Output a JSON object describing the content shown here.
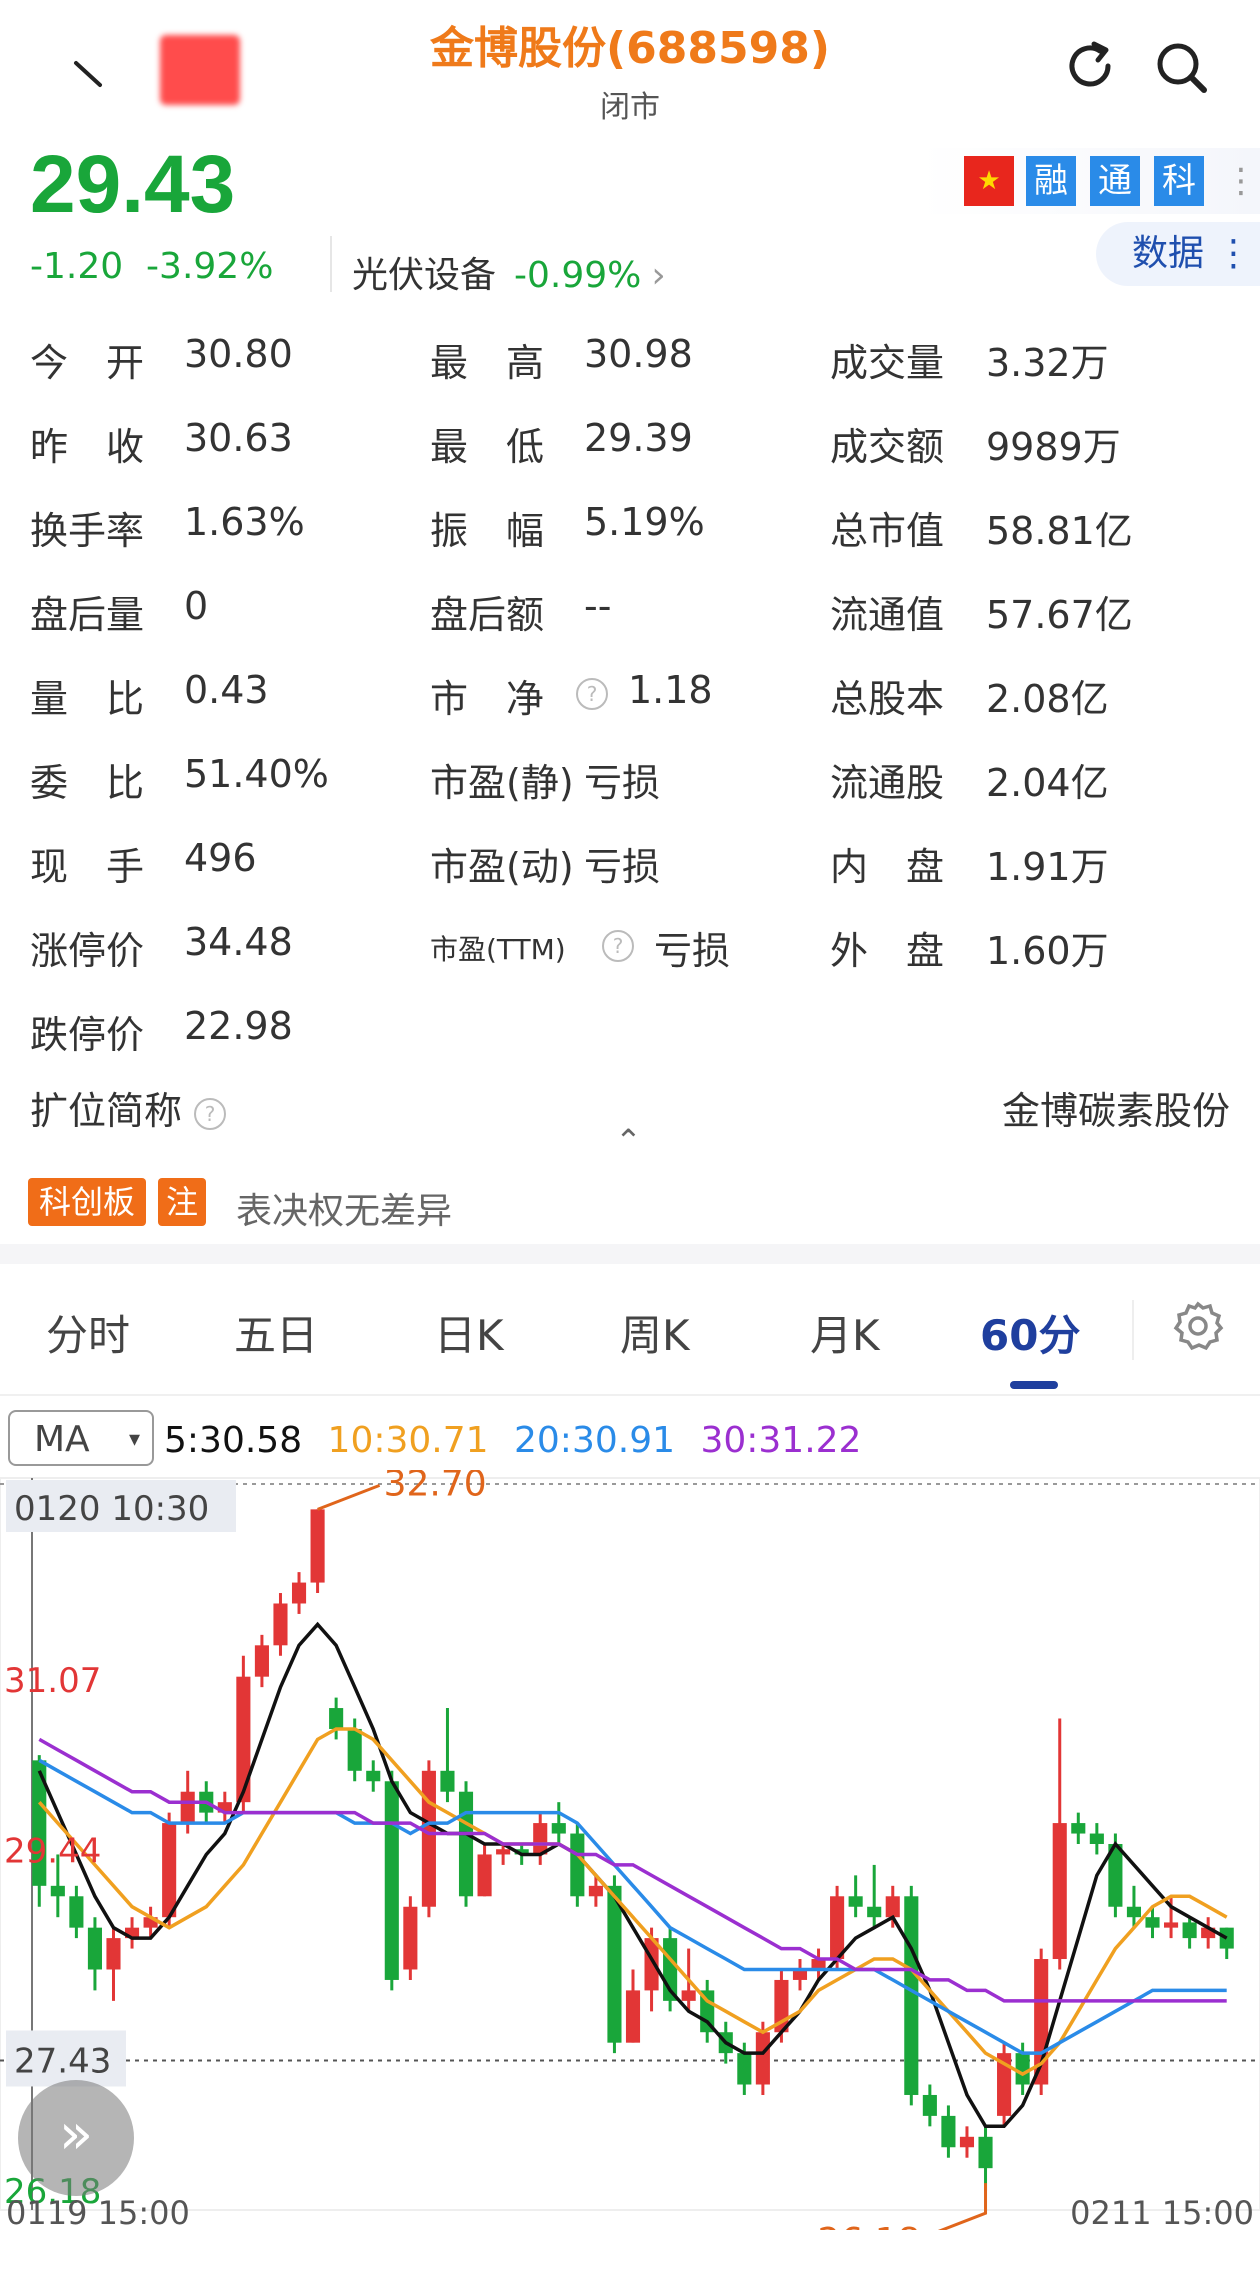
{
  "header": {
    "title": "金博股份(688598)",
    "status": "闭市",
    "back_icon": "back-arrow-icon",
    "refresh_icon": "refresh-icon",
    "search_icon": "search-icon"
  },
  "quote": {
    "price": "29.43",
    "change": "-1.20",
    "change_pct": "-3.92%",
    "sector": "光伏设备",
    "sector_pct": "-0.99%",
    "sector_arrow": "›",
    "color_down": "#19a63a",
    "color_up": "#e23636"
  },
  "badges": {
    "flag": "★",
    "b1": "融",
    "b2": "通",
    "b3": "科",
    "more": "⋮",
    "data_button": "数据 ⋮"
  },
  "stats": {
    "col1": [
      {
        "label": "今　开",
        "value": "30.80"
      },
      {
        "label": "昨　收",
        "value": "30.63"
      },
      {
        "label": "换手率",
        "value": "1.63%"
      },
      {
        "label": "盘后量",
        "value": "0"
      },
      {
        "label": "量　比",
        "value": "0.43"
      },
      {
        "label": "委　比",
        "value": "51.40%"
      },
      {
        "label": "现　手",
        "value": "496"
      },
      {
        "label": "涨停价",
        "value": "34.48"
      },
      {
        "label": "跌停价",
        "value": "22.98"
      }
    ],
    "col2": [
      {
        "label": "最　高",
        "value": "30.98"
      },
      {
        "label": "最　低",
        "value": "29.39"
      },
      {
        "label": "振　幅",
        "value": "5.19%"
      },
      {
        "label": "盘后额",
        "value": "--"
      },
      {
        "label": "市　净",
        "value": "1.18"
      },
      {
        "label": "市盈(静)",
        "value": "亏损"
      },
      {
        "label": "市盈(动)",
        "value": "亏损"
      },
      {
        "label": "市盈(TTM)",
        "value": "亏损"
      }
    ],
    "col3": [
      {
        "label": "成交量",
        "value": "3.32万"
      },
      {
        "label": "成交额",
        "value": "9989万"
      },
      {
        "label": "总市值",
        "value": "58.81亿"
      },
      {
        "label": "流通值",
        "value": "57.67亿"
      },
      {
        "label": "总股本",
        "value": "2.08亿"
      },
      {
        "label": "流通股",
        "value": "2.04亿"
      },
      {
        "label": "内　盘",
        "value": "1.91万"
      },
      {
        "label": "外　盘",
        "value": "1.60万"
      }
    ],
    "expand_label": "扩位简称",
    "expand_value": "金博碳素股份",
    "collapse": "⌃",
    "help_mark": "?"
  },
  "tags": {
    "board": "科创板",
    "note": "注",
    "text": "表决权无差异"
  },
  "tabs": [
    "分时",
    "五日",
    "日K",
    "周K",
    "月K",
    "60分"
  ],
  "active_tab": "60分",
  "settings_icon": "gear-icon",
  "ma": {
    "selector": "MA",
    "selector_arrow": "▾",
    "ma5": "5:30.58",
    "ma10": "10:30.71",
    "ma20": "20:30.91",
    "ma30": "30:31.22",
    "colors": {
      "ma5": "#111111",
      "ma10": "#f0a020",
      "ma20": "#2a8be8",
      "ma30": "#9b2fd0"
    }
  },
  "chart_data": {
    "type": "candlestick",
    "interval": "60分",
    "y_labels": [
      "31.07",
      "29.44",
      "27.43",
      "26.18"
    ],
    "high_label": "32.70",
    "low_label": "26.18",
    "crosshair_label": "0120 10:30",
    "dashed_level": "27.43",
    "x_start": "0119 15:00",
    "x_end": "0211 15:00",
    "ylim": [
      26.0,
      33.0
    ],
    "candles": [
      [
        30.3,
        29.1,
        30.35,
        28.9
      ],
      [
        29.1,
        29.0,
        29.4,
        28.8
      ],
      [
        29.0,
        28.7,
        29.1,
        28.6
      ],
      [
        28.7,
        28.3,
        28.8,
        28.1
      ],
      [
        28.3,
        28.6,
        28.7,
        28.0
      ],
      [
        28.6,
        28.7,
        28.8,
        28.5
      ],
      [
        28.7,
        28.8,
        28.9,
        28.6
      ],
      [
        28.8,
        29.7,
        29.8,
        28.7
      ],
      [
        29.7,
        30.0,
        30.2,
        29.6
      ],
      [
        30.0,
        29.8,
        30.1,
        29.7
      ],
      [
        29.8,
        29.9,
        30.0,
        29.7
      ],
      [
        29.9,
        31.1,
        31.3,
        29.8
      ],
      [
        31.1,
        31.4,
        31.5,
        31.0
      ],
      [
        31.4,
        31.8,
        31.9,
        31.3
      ],
      [
        31.8,
        32.0,
        32.1,
        31.7
      ],
      [
        32.0,
        32.7,
        32.7,
        31.9
      ],
      [
        30.8,
        30.6,
        30.9,
        30.5
      ],
      [
        30.6,
        30.2,
        30.7,
        30.1
      ],
      [
        30.2,
        30.1,
        30.3,
        30.0
      ],
      [
        30.1,
        28.2,
        30.2,
        28.1
      ],
      [
        28.3,
        28.9,
        29.0,
        28.2
      ],
      [
        28.9,
        30.2,
        30.3,
        28.8
      ],
      [
        30.2,
        30.0,
        30.8,
        29.9
      ],
      [
        30.0,
        29.0,
        30.1,
        28.9
      ],
      [
        29.0,
        29.4,
        29.5,
        29.0
      ],
      [
        29.4,
        29.45,
        29.5,
        29.3
      ],
      [
        29.45,
        29.4,
        29.5,
        29.3
      ],
      [
        29.4,
        29.7,
        29.8,
        29.3
      ],
      [
        29.7,
        29.6,
        29.9,
        29.5
      ],
      [
        29.6,
        29.0,
        29.7,
        28.9
      ],
      [
        29.0,
        29.1,
        29.2,
        28.9
      ],
      [
        29.1,
        27.6,
        29.2,
        27.5
      ],
      [
        27.6,
        28.1,
        28.3,
        27.6
      ],
      [
        28.1,
        28.6,
        28.7,
        27.9
      ],
      [
        28.6,
        28.0,
        28.7,
        27.9
      ],
      [
        28.0,
        28.1,
        28.5,
        27.9
      ],
      [
        28.1,
        27.7,
        28.2,
        27.6
      ],
      [
        27.7,
        27.5,
        27.8,
        27.4
      ],
      [
        27.5,
        27.2,
        27.6,
        27.1
      ],
      [
        27.2,
        27.7,
        27.8,
        27.1
      ],
      [
        27.7,
        28.2,
        28.3,
        27.6
      ],
      [
        28.2,
        28.3,
        28.4,
        28.1
      ],
      [
        28.3,
        28.4,
        28.5,
        28.2
      ],
      [
        28.4,
        29.0,
        29.1,
        28.3
      ],
      [
        29.0,
        28.9,
        29.2,
        28.8
      ],
      [
        28.9,
        28.8,
        29.3,
        28.7
      ],
      [
        28.8,
        29.0,
        29.1,
        28.7
      ],
      [
        29.0,
        27.1,
        29.1,
        27.0
      ],
      [
        27.1,
        26.9,
        27.2,
        26.8
      ],
      [
        26.9,
        26.6,
        27.0,
        26.5
      ],
      [
        26.6,
        26.7,
        26.8,
        26.5
      ],
      [
        26.7,
        26.4,
        26.8,
        26.18
      ],
      [
        26.9,
        27.5,
        27.6,
        26.8
      ],
      [
        27.5,
        27.2,
        27.6,
        27.1
      ],
      [
        27.2,
        28.4,
        28.5,
        27.1
      ],
      [
        28.4,
        29.7,
        30.7,
        28.3
      ],
      [
        29.7,
        29.6,
        29.8,
        29.5
      ],
      [
        29.6,
        29.5,
        29.7,
        29.4
      ],
      [
        29.5,
        28.9,
        29.6,
        28.8
      ],
      [
        28.9,
        28.8,
        29.1,
        28.7
      ],
      [
        28.8,
        28.7,
        28.9,
        28.6
      ],
      [
        28.7,
        28.75,
        29.0,
        28.6
      ],
      [
        28.75,
        28.6,
        28.8,
        28.5
      ],
      [
        28.6,
        28.7,
        28.8,
        28.5
      ],
      [
        28.7,
        28.5,
        28.7,
        28.4
      ]
    ],
    "series": [
      {
        "name": "MA5",
        "values": [
          30.2,
          29.8,
          29.4,
          29.0,
          28.7,
          28.6,
          28.6,
          28.8,
          29.1,
          29.4,
          29.6,
          30.0,
          30.5,
          31.0,
          31.4,
          31.6,
          31.4,
          31.0,
          30.6,
          30.1,
          29.8,
          29.7,
          29.6,
          29.6,
          29.5,
          29.5,
          29.4,
          29.4,
          29.5,
          29.4,
          29.2,
          29.0,
          28.7,
          28.4,
          28.1,
          27.9,
          27.8,
          27.6,
          27.5,
          27.5,
          27.7,
          27.9,
          28.2,
          28.4,
          28.6,
          28.7,
          28.8,
          28.5,
          28.1,
          27.6,
          27.1,
          26.8,
          26.8,
          27.0,
          27.4,
          28.0,
          28.6,
          29.2,
          29.5,
          29.3,
          29.1,
          28.9,
          28.8,
          28.7,
          28.6
        ]
      },
      {
        "name": "MA10",
        "values": [
          29.9,
          29.7,
          29.5,
          29.3,
          29.1,
          28.9,
          28.8,
          28.7,
          28.8,
          28.9,
          29.1,
          29.3,
          29.6,
          29.9,
          30.2,
          30.5,
          30.6,
          30.6,
          30.5,
          30.3,
          30.1,
          29.9,
          29.8,
          29.7,
          29.6,
          29.5,
          29.5,
          29.5,
          29.5,
          29.4,
          29.2,
          29.0,
          28.8,
          28.6,
          28.4,
          28.2,
          28.0,
          27.9,
          27.8,
          27.7,
          27.8,
          27.9,
          28.1,
          28.2,
          28.3,
          28.4,
          28.4,
          28.3,
          28.1,
          27.9,
          27.7,
          27.5,
          27.4,
          27.3,
          27.4,
          27.6,
          27.9,
          28.2,
          28.5,
          28.7,
          28.9,
          29.0,
          29.0,
          28.9,
          28.8
        ]
      },
      {
        "name": "MA20",
        "values": [
          30.3,
          30.2,
          30.1,
          30.0,
          29.9,
          29.8,
          29.8,
          29.7,
          29.7,
          29.7,
          29.7,
          29.8,
          29.8,
          29.8,
          29.8,
          29.8,
          29.8,
          29.7,
          29.7,
          29.7,
          29.6,
          29.7,
          29.7,
          29.8,
          29.8,
          29.8,
          29.8,
          29.8,
          29.8,
          29.7,
          29.5,
          29.3,
          29.1,
          28.9,
          28.7,
          28.6,
          28.5,
          28.4,
          28.3,
          28.3,
          28.3,
          28.3,
          28.3,
          28.3,
          28.3,
          28.3,
          28.2,
          28.1,
          28.0,
          27.9,
          27.8,
          27.7,
          27.6,
          27.5,
          27.5,
          27.6,
          27.7,
          27.8,
          27.9,
          28.0,
          28.1,
          28.1,
          28.1,
          28.1,
          28.1
        ]
      },
      {
        "name": "MA30",
        "values": [
          30.5,
          30.4,
          30.3,
          30.2,
          30.1,
          30.0,
          30.0,
          29.9,
          29.9,
          29.9,
          29.8,
          29.8,
          29.8,
          29.8,
          29.8,
          29.8,
          29.8,
          29.8,
          29.7,
          29.7,
          29.7,
          29.6,
          29.6,
          29.6,
          29.6,
          29.5,
          29.5,
          29.5,
          29.5,
          29.4,
          29.4,
          29.3,
          29.3,
          29.2,
          29.1,
          29.0,
          28.9,
          28.8,
          28.7,
          28.6,
          28.5,
          28.5,
          28.4,
          28.4,
          28.3,
          28.3,
          28.3,
          28.3,
          28.2,
          28.2,
          28.1,
          28.1,
          28.0,
          28.0,
          28.0,
          28.0,
          28.0,
          28.0,
          28.0,
          28.0,
          28.0,
          28.0,
          28.0,
          28.0,
          28.0
        ]
      }
    ]
  }
}
